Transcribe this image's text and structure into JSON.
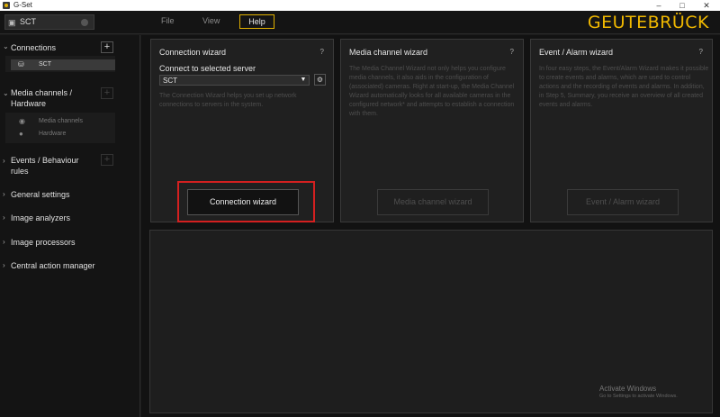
{
  "window": {
    "title": "G-Set",
    "minimize_icon": "minimize-icon",
    "maximize_icon": "maximize-icon",
    "close_icon": "close-icon"
  },
  "toolbar": {
    "server_name": "SCT",
    "menu": [
      "File",
      "View",
      "Help"
    ],
    "active_menu": "Help",
    "brand": "GEUTEBRÜCK",
    "brand_color": "#f0b800",
    "accent_color": "#e0b000"
  },
  "sidebar": {
    "connections": {
      "label": "Connections",
      "add_label": "+",
      "items": [
        {
          "label": "SCT",
          "icon": "server-icon"
        }
      ]
    },
    "media": {
      "label_line1": "Media channels /",
      "label_line2": "Hardware",
      "add_label": "+",
      "items": [
        {
          "label": "Media channels",
          "icon": "camera-icon"
        },
        {
          "label": "Hardware",
          "icon": "hardware-icon"
        }
      ]
    },
    "events": {
      "label_line1": "Events / Behaviour",
      "label_line2": "rules",
      "add_label": "+"
    },
    "others": [
      "General settings",
      "Image analyzers",
      "Image processors",
      "Central action manager"
    ]
  },
  "cards": {
    "connection": {
      "title": "Connection wizard",
      "help": "?",
      "connect_label": "Connect to selected server",
      "server_value": "SCT",
      "description": "The Connection Wizard helps you set up network connections to servers in the system.",
      "button": "Connection wizard"
    },
    "media": {
      "title": "Media channel wizard",
      "help": "?",
      "description": "The Media Channel Wizard not only helps you configure media channels, it also aids in the configuration of (associated) cameras. Right at start-up, the Media Channel Wizard automatically looks for all available cameras in the configured network* and attempts to establish a connection with them.",
      "button": "Media channel wizard"
    },
    "event": {
      "title": "Event / Alarm wizard",
      "help": "?",
      "description": "In four easy steps, the Event/Alarm Wizard makes it possible to create events and alarms, which are used to control actions and the recording of events and alarms. In addition, in Step 5, Summary, you receive an overview of all created events and alarms.",
      "button": "Event / Alarm wizard"
    }
  },
  "watermark": {
    "line1": "Activate Windows",
    "line2": "Go to Settings to activate Windows."
  }
}
